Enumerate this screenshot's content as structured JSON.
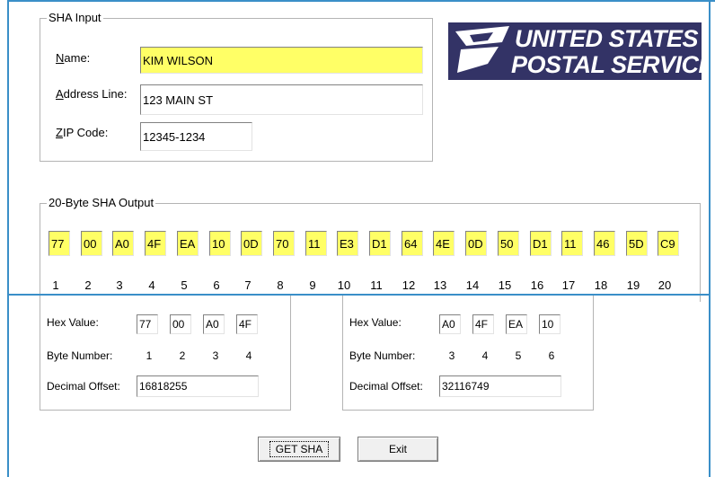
{
  "sha_input": {
    "legend": "SHA Input",
    "name_label": "Name:",
    "name_value": "KIM WILSON",
    "address_label": "Address Line:",
    "address_value": "123 MAIN ST",
    "zip_label": "ZIP Code:",
    "zip_value": "12345-1234"
  },
  "logo": {
    "line1": "UNITED STATES",
    "line2": "POSTAL SERVICE."
  },
  "sha_output": {
    "legend": "20-Byte SHA Output",
    "bytes": [
      "77",
      "00",
      "A0",
      "4F",
      "EA",
      "10",
      "0D",
      "70",
      "11",
      "E3",
      "D1",
      "64",
      "4E",
      "0D",
      "50",
      "D1",
      "11",
      "46",
      "5D",
      "C9"
    ],
    "indexes": [
      "1",
      "2",
      "3",
      "4",
      "5",
      "6",
      "7",
      "8",
      "9",
      "10",
      "11",
      "12",
      "13",
      "14",
      "15",
      "16",
      "17",
      "18",
      "19",
      "20"
    ]
  },
  "group_a": {
    "hex_label": "Hex Value:",
    "hex": [
      "77",
      "00",
      "A0",
      "4F"
    ],
    "byte_label": "Byte Number:",
    "bytes": [
      "1",
      "2",
      "3",
      "4"
    ],
    "offset_label": "Decimal Offset:",
    "offset_value": "16818255"
  },
  "group_b": {
    "hex_label": "Hex Value:",
    "hex": [
      "A0",
      "4F",
      "EA",
      "10"
    ],
    "byte_label": "Byte Number:",
    "bytes": [
      "3",
      "4",
      "5",
      "6"
    ],
    "offset_label": "Decimal Offset:",
    "offset_value": "32116749"
  },
  "buttons": {
    "get_sha": "GET SHA",
    "exit": "Exit"
  },
  "colors": {
    "highlight": "#ffff66",
    "usps_blue": "#333366",
    "accent_line": "#3a8fc8"
  }
}
